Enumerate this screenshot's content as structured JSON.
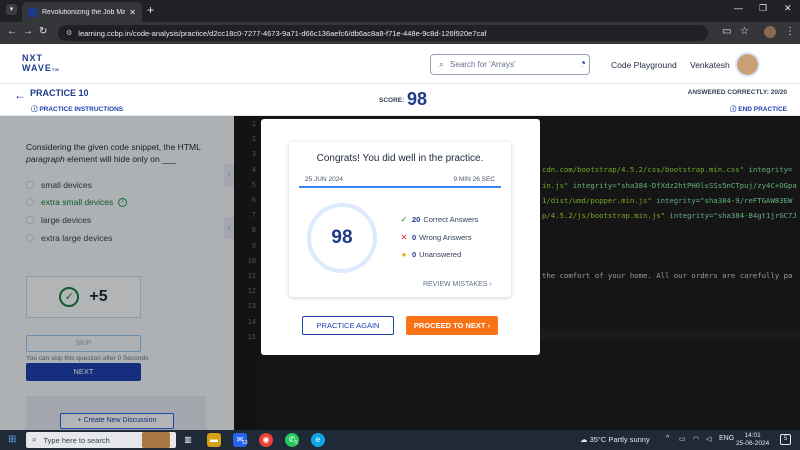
{
  "browser": {
    "tab_title": "Revolutionizing the Job Market",
    "url": "learning.ccbp.in/code-analysis/practice/d2cc18c0-7277-4673-9a71-d66c136aefc6/db6ac8a8-f71e-448e-9c8d-126f920e7caf"
  },
  "header": {
    "logo_line1": "NXT",
    "logo_line2": "WAVE",
    "logo_tm": "TM",
    "search_placeholder": "Search for 'Arrays'",
    "code_playground": "Code Playground",
    "username": "Venkatesh"
  },
  "practice_bar": {
    "title": "PRACTICE 10",
    "instructions": "PRACTICE INSTRUCTIONS",
    "score_label": "SCORE:",
    "score": "98",
    "answered": "ANSWERED CORRECTLY: 20/20",
    "end": "END PRACTICE"
  },
  "question": {
    "text_before": "Considering the given code snippet, the HTML ",
    "text_em": "paragraph",
    "text_after": " element will hide only on ___",
    "options": [
      "small devices",
      "extra small devices",
      "large devices",
      "extra large devices"
    ],
    "correct_index": 1,
    "points": "+5",
    "skip_label": "SKIP",
    "skip_note": "You can skip this question after 0 Seconds",
    "next_label": "NEXT",
    "discussion_label": "+ Create New Discussion"
  },
  "editor": {
    "line_numbers": [
      "1",
      "2",
      "3",
      "4",
      "5",
      "6",
      "7",
      "8",
      "9",
      "10",
      "11",
      "12",
      "13",
      "14",
      "15"
    ],
    "code_lines": [
      {
        "code": "cdn.com/bootstrap/4.5.2/css/bootstrap.min.css\"",
        "attr": "integrity="
      },
      {
        "code": "in.js\"",
        "attr": "integrity=\"sha384-DfXdz2htPH0lsSSs5nCTpuj/zy4C+OGpa"
      },
      {
        "code": "1/dist/umd/popper.min.js\"",
        "attr": "integrity=\"sha384-9/reFTGAW83EW"
      },
      {
        "code": "p/4.5.2/js/bootstrap.min.js\"",
        "attr": "integrity=\"sha384-B4gt1jrGC7J"
      },
      {
        "text": "the comfort of your home. All our orders are carefully pa"
      }
    ]
  },
  "modal": {
    "title": "Congrats! You did well in the practice.",
    "date": "25 JUN 2024",
    "duration": "9 MIN 26 SEC",
    "score": "98",
    "correct_count": "20",
    "correct_label": "Correct Answers",
    "wrong_count": "0",
    "wrong_label": "Wrong Answers",
    "unanswered_count": "0",
    "unanswered_label": "Unanswered",
    "review": "REVIEW MISTAKES",
    "practice_again": "PRACTICE AGAIN",
    "proceed": "PROCEED TO NEXT"
  },
  "taskbar": {
    "search": "Type here to search",
    "mail_badge": "13",
    "whatsapp_badge": "5",
    "weather": "35°C  Partly sunny",
    "lang": "ENG",
    "time": "14:01",
    "date": "25-06-2024",
    "notif_count": "5"
  },
  "colors": {
    "brand": "#1e3a8a",
    "accent_orange": "#f97316",
    "correct_green": "#15803d",
    "wrong_red": "#dc2626",
    "unanswered_yellow": "#eab308"
  }
}
